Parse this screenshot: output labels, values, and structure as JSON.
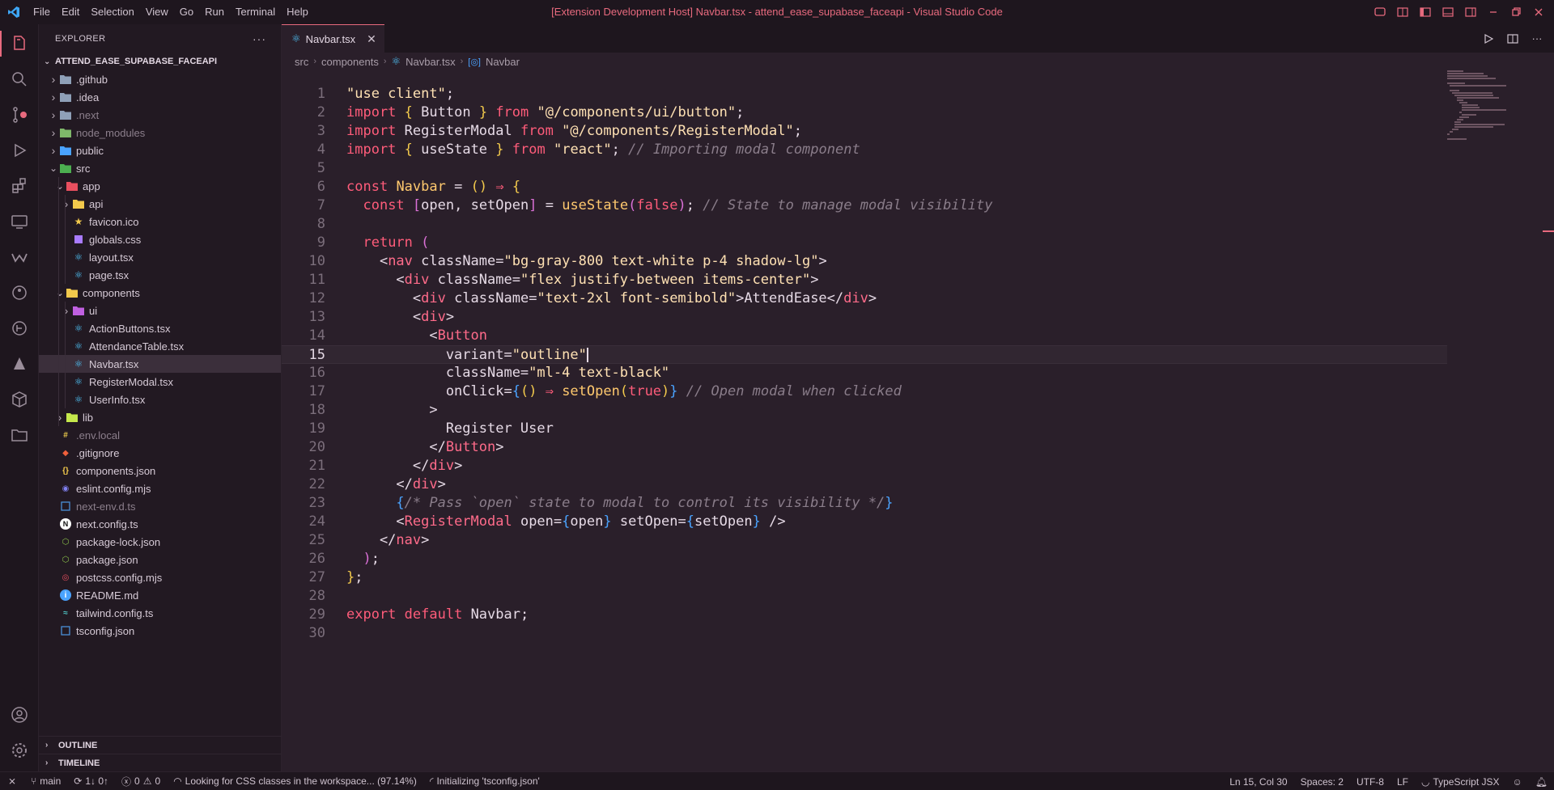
{
  "menu": [
    "File",
    "Edit",
    "Selection",
    "View",
    "Go",
    "Run",
    "Terminal",
    "Help"
  ],
  "window_title": "[Extension Development Host] Navbar.tsx - attend_ease_supabase_faceapi - Visual Studio Code",
  "colors": {
    "accent": "#e86a7e",
    "background": "#2a1f2a",
    "sidebar": "#221922",
    "keyword": "#ff5c7a",
    "string": "#ffe1b3",
    "comment": "#8a7d8a"
  },
  "sidebar": {
    "header": "EXPLORER",
    "more_icon": "ellipsis-icon",
    "root": "ATTEND_EASE_SUPABASE_FACEAPI",
    "items": [
      {
        "label": ".github",
        "depth": 1,
        "chevron": "right",
        "icon": "folder-github-icon",
        "color": "#8fa0b8",
        "dim": false
      },
      {
        "label": ".idea",
        "depth": 1,
        "chevron": "right",
        "icon": "folder-idea-icon",
        "color": "#8fa0b8",
        "dim": false
      },
      {
        "label": ".next",
        "depth": 1,
        "chevron": "right",
        "icon": "folder-next-icon",
        "color": "#8fa0b8",
        "dim": true
      },
      {
        "label": "node_modules",
        "depth": 1,
        "chevron": "right",
        "icon": "folder-node-icon",
        "color": "#7fb86a",
        "dim": true
      },
      {
        "label": "public",
        "depth": 1,
        "chevron": "right",
        "icon": "folder-public-icon",
        "color": "#4aa3ff",
        "dim": false
      },
      {
        "label": "src",
        "depth": 1,
        "chevron": "down",
        "icon": "folder-src-icon",
        "color": "#4caf50",
        "dim": false
      },
      {
        "label": "app",
        "depth": 2,
        "chevron": "down",
        "icon": "folder-app-icon",
        "color": "#e94f5f",
        "dim": false
      },
      {
        "label": "api",
        "depth": 3,
        "chevron": "right",
        "icon": "folder-api-icon",
        "color": "#f2c94c",
        "dim": false
      },
      {
        "label": "favicon.ico",
        "depth": 3,
        "chevron": "",
        "icon": "star-icon",
        "color": "#f2c94c",
        "dim": false
      },
      {
        "label": "globals.css",
        "depth": 3,
        "chevron": "",
        "icon": "css-icon",
        "color": "#a97bff",
        "dim": false
      },
      {
        "label": "layout.tsx",
        "depth": 3,
        "chevron": "",
        "icon": "react-icon",
        "color": "#4fc3f7",
        "dim": false
      },
      {
        "label": "page.tsx",
        "depth": 3,
        "chevron": "",
        "icon": "react-icon",
        "color": "#4fc3f7",
        "dim": false
      },
      {
        "label": "components",
        "depth": 2,
        "chevron": "down",
        "icon": "folder-components-icon",
        "color": "#f2c94c",
        "dim": false
      },
      {
        "label": "ui",
        "depth": 3,
        "chevron": "right",
        "icon": "folder-ui-icon",
        "color": "#c060e0",
        "dim": false
      },
      {
        "label": "ActionButtons.tsx",
        "depth": 3,
        "chevron": "",
        "icon": "react-icon",
        "color": "#4fc3f7",
        "dim": false
      },
      {
        "label": "AttendanceTable.tsx",
        "depth": 3,
        "chevron": "",
        "icon": "react-icon",
        "color": "#4fc3f7",
        "dim": false
      },
      {
        "label": "Navbar.tsx",
        "depth": 3,
        "chevron": "",
        "icon": "react-icon",
        "color": "#4fc3f7",
        "dim": false,
        "selected": true
      },
      {
        "label": "RegisterModal.tsx",
        "depth": 3,
        "chevron": "",
        "icon": "react-icon",
        "color": "#4fc3f7",
        "dim": false
      },
      {
        "label": "UserInfo.tsx",
        "depth": 3,
        "chevron": "",
        "icon": "react-icon",
        "color": "#4fc3f7",
        "dim": false
      },
      {
        "label": "lib",
        "depth": 2,
        "chevron": "right",
        "icon": "folder-lib-icon",
        "color": "#c5e84c",
        "dim": false
      },
      {
        "label": ".env.local",
        "depth": 1,
        "chevron": "",
        "icon": "env-icon",
        "color": "#e8c84c",
        "dim": true
      },
      {
        "label": ".gitignore",
        "depth": 1,
        "chevron": "",
        "icon": "git-icon",
        "color": "#f0603c",
        "dim": false
      },
      {
        "label": "components.json",
        "depth": 1,
        "chevron": "",
        "icon": "json-icon",
        "color": "#f2c94c",
        "dim": false
      },
      {
        "label": "eslint.config.mjs",
        "depth": 1,
        "chevron": "",
        "icon": "eslint-icon",
        "color": "#8080f0",
        "dim": false
      },
      {
        "label": "next-env.d.ts",
        "depth": 1,
        "chevron": "",
        "icon": "ts-icon",
        "color": "#4a8fd8",
        "dim": true
      },
      {
        "label": "next.config.ts",
        "depth": 1,
        "chevron": "",
        "icon": "next-icon",
        "color": "#ffffff",
        "dim": false
      },
      {
        "label": "package-lock.json",
        "depth": 1,
        "chevron": "",
        "icon": "npm-icon",
        "color": "#8bc34a",
        "dim": false
      },
      {
        "label": "package.json",
        "depth": 1,
        "chevron": "",
        "icon": "npm-icon",
        "color": "#8bc34a",
        "dim": false
      },
      {
        "label": "postcss.config.mjs",
        "depth": 1,
        "chevron": "",
        "icon": "postcss-icon",
        "color": "#e94f5f",
        "dim": false
      },
      {
        "label": "README.md",
        "depth": 1,
        "chevron": "",
        "icon": "info-icon",
        "color": "#4aa3ff",
        "dim": false
      },
      {
        "label": "tailwind.config.ts",
        "depth": 1,
        "chevron": "",
        "icon": "tailwind-icon",
        "color": "#4fc3c3",
        "dim": false
      },
      {
        "label": "tsconfig.json",
        "depth": 1,
        "chevron": "",
        "icon": "tsconfig-icon",
        "color": "#4a8fd8",
        "dim": false
      }
    ],
    "outline": "OUTLINE",
    "timeline": "TIMELINE"
  },
  "editor": {
    "tab": "Navbar.tsx",
    "breadcrumb": [
      "src",
      "components",
      "Navbar.tsx",
      "Navbar"
    ],
    "current_line": 15,
    "lines": [
      [
        [
          "s",
          "\"use client\""
        ],
        [
          "p",
          ";"
        ]
      ],
      [
        [
          "k",
          "import"
        ],
        [
          "p",
          " "
        ],
        [
          "b1",
          "{"
        ],
        [
          "p",
          " Button "
        ],
        [
          "b1",
          "}"
        ],
        [
          "p",
          " "
        ],
        [
          "k",
          "from"
        ],
        [
          "p",
          " "
        ],
        [
          "s",
          "\"@/components/ui/button\""
        ],
        [
          "p",
          ";"
        ]
      ],
      [
        [
          "k",
          "import"
        ],
        [
          "p",
          " RegisterModal "
        ],
        [
          "k",
          "from"
        ],
        [
          "p",
          " "
        ],
        [
          "s",
          "\"@/components/RegisterModal\""
        ],
        [
          "p",
          ";"
        ]
      ],
      [
        [
          "k",
          "import"
        ],
        [
          "p",
          " "
        ],
        [
          "b1",
          "{"
        ],
        [
          "p",
          " useState "
        ],
        [
          "b1",
          "}"
        ],
        [
          "p",
          " "
        ],
        [
          "k",
          "from"
        ],
        [
          "p",
          " "
        ],
        [
          "s",
          "\"react\""
        ],
        [
          "p",
          "; "
        ],
        [
          "c",
          "// Importing modal component"
        ]
      ],
      [],
      [
        [
          "k",
          "const"
        ],
        [
          "p",
          " "
        ],
        [
          "f",
          "Navbar"
        ],
        [
          "p",
          " = "
        ],
        [
          "b1",
          "()"
        ],
        [
          "p",
          " "
        ],
        [
          "k",
          "⇒"
        ],
        [
          "p",
          " "
        ],
        [
          "b1",
          "{"
        ]
      ],
      [
        [
          "p",
          "  "
        ],
        [
          "k",
          "const"
        ],
        [
          "p",
          " "
        ],
        [
          "b2",
          "["
        ],
        [
          "p",
          "open, setOpen"
        ],
        [
          "b2",
          "]"
        ],
        [
          "p",
          " = "
        ],
        [
          "f",
          "useState"
        ],
        [
          "b2",
          "("
        ],
        [
          "k",
          "false"
        ],
        [
          "b2",
          ")"
        ],
        [
          "p",
          "; "
        ],
        [
          "c",
          "// State to manage modal visibility"
        ]
      ],
      [],
      [
        [
          "p",
          "  "
        ],
        [
          "k",
          "return"
        ],
        [
          "p",
          " "
        ],
        [
          "b2",
          "("
        ]
      ],
      [
        [
          "p",
          "    <"
        ],
        [
          "t",
          "nav"
        ],
        [
          "p",
          " className="
        ],
        [
          "s",
          "\"bg-gray-800 text-white p-4 shadow-lg\""
        ],
        [
          "p",
          ">"
        ]
      ],
      [
        [
          "p",
          "      <"
        ],
        [
          "t",
          "div"
        ],
        [
          "p",
          " className="
        ],
        [
          "s",
          "\"flex justify-between items-center\""
        ],
        [
          "p",
          ">"
        ]
      ],
      [
        [
          "p",
          "        <"
        ],
        [
          "t",
          "div"
        ],
        [
          "p",
          " className="
        ],
        [
          "s",
          "\"text-2xl font-semibold\""
        ],
        [
          "p",
          ">AttendEase</"
        ],
        [
          "t",
          "div"
        ],
        [
          "p",
          ">"
        ]
      ],
      [
        [
          "p",
          "        <"
        ],
        [
          "t",
          "div"
        ],
        [
          "p",
          ">"
        ]
      ],
      [
        [
          "p",
          "          <"
        ],
        [
          "t",
          "Button"
        ]
      ],
      [
        [
          "p",
          "            variant="
        ],
        [
          "s",
          "\"outline\""
        ],
        [
          "cur",
          ""
        ]
      ],
      [
        [
          "p",
          "            className="
        ],
        [
          "s",
          "\"ml-4 text-black\""
        ]
      ],
      [
        [
          "p",
          "            onClick="
        ],
        [
          "b3",
          "{"
        ],
        [
          "b1",
          "()"
        ],
        [
          "p",
          " "
        ],
        [
          "k",
          "⇒"
        ],
        [
          "p",
          " "
        ],
        [
          "f",
          "setOpen"
        ],
        [
          "b1",
          "("
        ],
        [
          "k",
          "true"
        ],
        [
          "b1",
          ")"
        ],
        [
          "b3",
          "}"
        ],
        [
          "p",
          " "
        ],
        [
          "c",
          "// Open modal when clicked"
        ]
      ],
      [
        [
          "p",
          "          >"
        ]
      ],
      [
        [
          "p",
          "            Register User"
        ]
      ],
      [
        [
          "p",
          "          </"
        ],
        [
          "t",
          "Button"
        ],
        [
          "p",
          ">"
        ]
      ],
      [
        [
          "p",
          "        </"
        ],
        [
          "t",
          "div"
        ],
        [
          "p",
          ">"
        ]
      ],
      [
        [
          "p",
          "      </"
        ],
        [
          "t",
          "div"
        ],
        [
          "p",
          ">"
        ]
      ],
      [
        [
          "p",
          "      "
        ],
        [
          "b3",
          "{"
        ],
        [
          "c",
          "/* Pass `open` state to modal to control its visibility */"
        ],
        [
          "b3",
          "}"
        ]
      ],
      [
        [
          "p",
          "      <"
        ],
        [
          "t",
          "RegisterModal"
        ],
        [
          "p",
          " open="
        ],
        [
          "b3",
          "{"
        ],
        [
          "p",
          "open"
        ],
        [
          "b3",
          "}"
        ],
        [
          "p",
          " setOpen="
        ],
        [
          "b3",
          "{"
        ],
        [
          "p",
          "setOpen"
        ],
        [
          "b3",
          "}"
        ],
        [
          "p",
          " />"
        ]
      ],
      [
        [
          "p",
          "    </"
        ],
        [
          "t",
          "nav"
        ],
        [
          "p",
          ">"
        ]
      ],
      [
        [
          "p",
          "  "
        ],
        [
          "b2",
          ")"
        ],
        [
          "p",
          ";"
        ]
      ],
      [
        [
          "b1",
          "}"
        ],
        [
          "p",
          ";"
        ]
      ],
      [],
      [
        [
          "k",
          "export"
        ],
        [
          "p",
          " "
        ],
        [
          "k",
          "default"
        ],
        [
          "p",
          " Navbar;"
        ]
      ],
      []
    ]
  },
  "status": {
    "branch": "main",
    "sync": "1↓ 0↑",
    "problems": "0",
    "warnings": "0",
    "css_scan": "Looking for CSS classes in the workspace... (97.14%)",
    "ts_init": "Initializing 'tsconfig.json'",
    "position": "Ln 15, Col 30",
    "spaces": "Spaces: 2",
    "encoding": "UTF-8",
    "eol": "LF",
    "language": "TypeScript JSX"
  }
}
